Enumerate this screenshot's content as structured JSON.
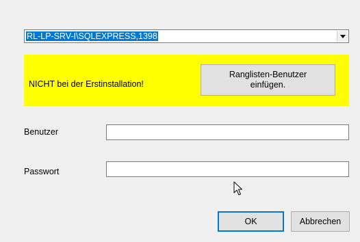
{
  "server": {
    "selected": "RL-LP-SRV-I\\SQLEXPRESS,1398"
  },
  "notice": {
    "text": "NICHT bei der Erstinstallation!",
    "button_line1": "Ranglisten-Benutzer",
    "button_line2": "einfügen."
  },
  "form": {
    "user_label": "Benutzer",
    "user_value": "",
    "password_label": "Passwort",
    "password_value": ""
  },
  "buttons": {
    "ok": "OK",
    "cancel": "Abbrechen"
  },
  "icons": {
    "dropdown": "chevron-down-icon",
    "cursor": "mouse-pointer-icon"
  },
  "colors": {
    "panel_background": "#ffff00",
    "selection": "#0078d7",
    "window": "#f0f0f0"
  }
}
